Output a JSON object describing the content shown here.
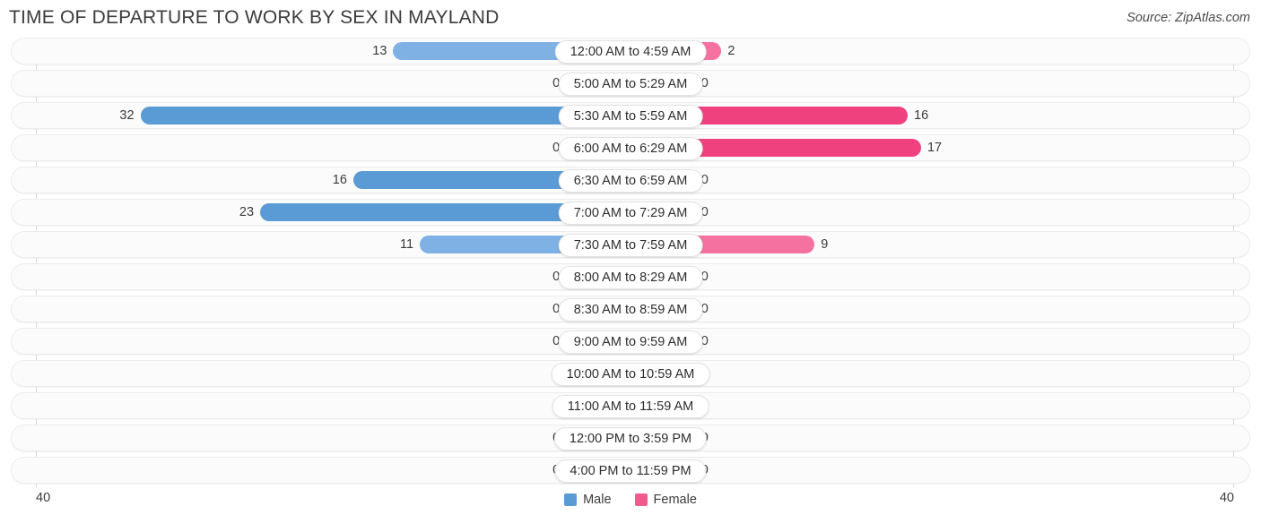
{
  "header": {
    "title": "TIME OF DEPARTURE TO WORK BY SEX IN MAYLAND",
    "source": "Source: ZipAtlas.com"
  },
  "axis": {
    "left_tick": "40",
    "right_tick": "40"
  },
  "legend": {
    "items": [
      {
        "label": "Male",
        "color": "#5B9BD5"
      },
      {
        "label": "Female",
        "color": "#F05B8E"
      }
    ]
  },
  "chart_data": {
    "type": "bar",
    "orientation": "horizontal-diverging",
    "title": "TIME OF DEPARTURE TO WORK BY SEX IN MAYLAND",
    "xlabel": "",
    "ylabel": "",
    "xlim": [
      40,
      40
    ],
    "axis_max": 40,
    "grid": false,
    "legend_position": "bottom-center",
    "categories": [
      "12:00 AM to 4:59 AM",
      "5:00 AM to 5:29 AM",
      "5:30 AM to 5:59 AM",
      "6:00 AM to 6:29 AM",
      "6:30 AM to 6:59 AM",
      "7:00 AM to 7:29 AM",
      "7:30 AM to 7:59 AM",
      "8:00 AM to 8:29 AM",
      "8:30 AM to 8:59 AM",
      "9:00 AM to 9:59 AM",
      "10:00 AM to 10:59 AM",
      "11:00 AM to 11:59 AM",
      "12:00 PM to 3:59 PM",
      "4:00 PM to 11:59 PM"
    ],
    "series": [
      {
        "name": "Male",
        "color": "#5B9BD5",
        "values": [
          13,
          0,
          32,
          0,
          16,
          23,
          11,
          0,
          0,
          0,
          0,
          0,
          0,
          0
        ]
      },
      {
        "name": "Female",
        "color": "#F05B8E",
        "values": [
          2,
          0,
          16,
          17,
          0,
          0,
          9,
          0,
          0,
          0,
          0,
          0,
          0,
          0
        ]
      }
    ]
  },
  "rows": [
    {
      "label": "12:00 AM to 4:59 AM",
      "male": "13",
      "female": "2"
    },
    {
      "label": "5:00 AM to 5:29 AM",
      "male": "0",
      "female": "0"
    },
    {
      "label": "5:30 AM to 5:59 AM",
      "male": "32",
      "female": "16"
    },
    {
      "label": "6:00 AM to 6:29 AM",
      "male": "0",
      "female": "17"
    },
    {
      "label": "6:30 AM to 6:59 AM",
      "male": "16",
      "female": "0"
    },
    {
      "label": "7:00 AM to 7:29 AM",
      "male": "23",
      "female": "0"
    },
    {
      "label": "7:30 AM to 7:59 AM",
      "male": "11",
      "female": "9"
    },
    {
      "label": "8:00 AM to 8:29 AM",
      "male": "0",
      "female": "0"
    },
    {
      "label": "8:30 AM to 8:59 AM",
      "male": "0",
      "female": "0"
    },
    {
      "label": "9:00 AM to 9:59 AM",
      "male": "0",
      "female": "0"
    },
    {
      "label": "10:00 AM to 10:59 AM",
      "male": "0",
      "female": "0"
    },
    {
      "label": "11:00 AM to 11:59 AM",
      "male": "0",
      "female": "0"
    },
    {
      "label": "12:00 PM to 3:59 PM",
      "male": "0",
      "female": "0"
    },
    {
      "label": "4:00 PM to 11:59 PM",
      "male": "0",
      "female": "0"
    }
  ]
}
